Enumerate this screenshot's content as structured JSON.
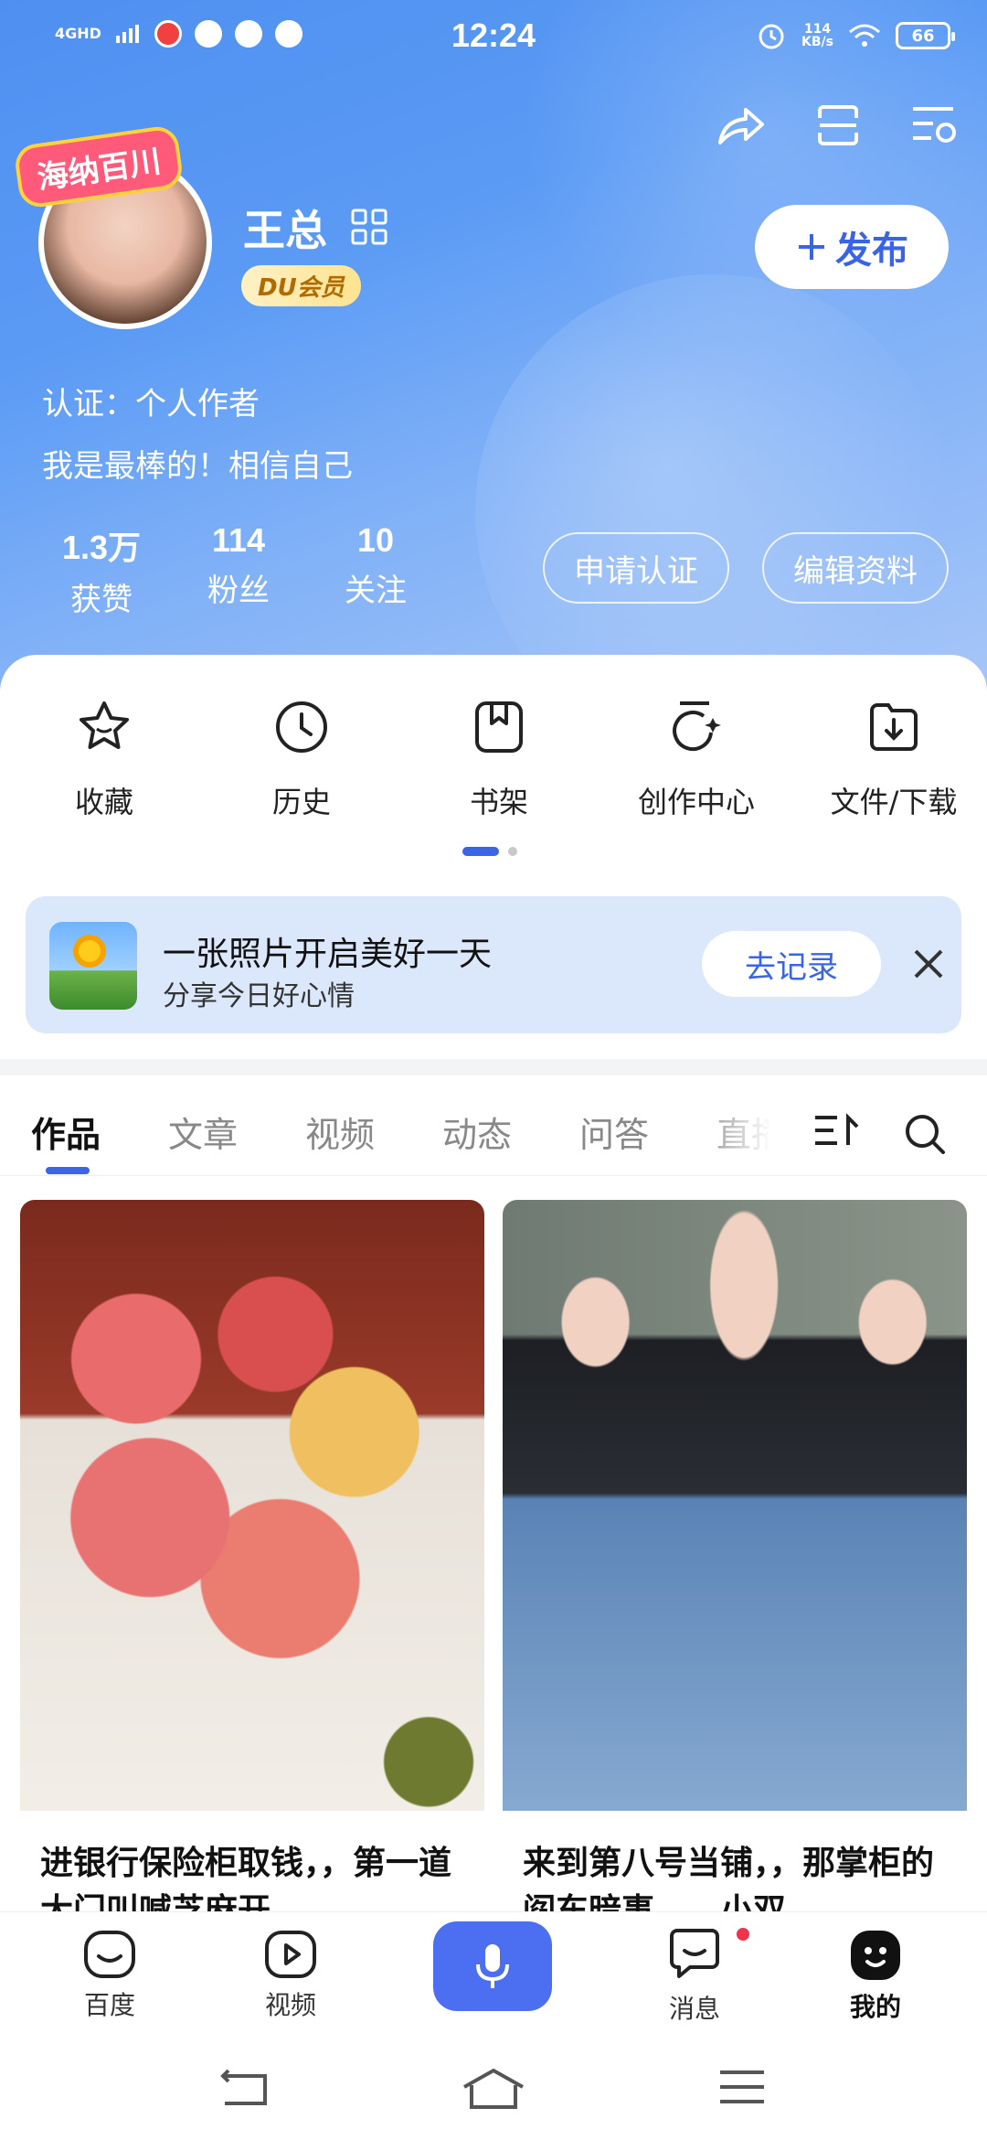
{
  "status_bar": {
    "network": "4GHD",
    "time": "12:24",
    "speed_value": "114",
    "speed_unit": "KB/s",
    "battery": "66"
  },
  "profile": {
    "sticker_text": "海纳百川",
    "username": "王总",
    "vip_badge": "DU会员",
    "publish_label": "发布",
    "certification": "认证：个人作者",
    "bio": "我是最棒的！相信自己",
    "stats": [
      {
        "value": "1.3万",
        "label": "获赞"
      },
      {
        "value": "114",
        "label": "粉丝"
      },
      {
        "value": "10",
        "label": "关注"
      }
    ],
    "apply_cert_label": "申请认证",
    "edit_profile_label": "编辑资料"
  },
  "quick_actions": [
    {
      "label": "收藏",
      "icon": "star-icon"
    },
    {
      "label": "历史",
      "icon": "clock-icon"
    },
    {
      "label": "书架",
      "icon": "bookmark-icon"
    },
    {
      "label": "创作中心",
      "icon": "create-icon"
    },
    {
      "label": "文件/下载",
      "icon": "download-icon"
    }
  ],
  "banner": {
    "title": "一张照片开启美好一天",
    "subtitle": "分享今日好心情",
    "action_label": "去记录"
  },
  "content_tabs": [
    "作品",
    "文章",
    "视频",
    "动态",
    "问答",
    "直播"
  ],
  "active_tab": "作品",
  "posts": [
    {
      "title": "进银行保险柜取钱，，第一道大门叫喊芝麻开"
    },
    {
      "title": "来到第八号当铺，，那掌柜的阎东暗事……小双"
    }
  ],
  "bottom_nav": [
    {
      "label": "百度",
      "icon": "baidu-face-icon"
    },
    {
      "label": "视频",
      "icon": "video-play-icon"
    },
    {
      "label": "",
      "icon": "microphone-icon"
    },
    {
      "label": "消息",
      "icon": "message-icon"
    },
    {
      "label": "我的",
      "icon": "me-icon"
    }
  ],
  "colors": {
    "accent": "#3c64e6",
    "header_gradient_start": "#4f8ff0",
    "header_gradient_end": "#a9c7f8",
    "banner_bg": "#dbe8fb",
    "notification_dot": "#f2334b"
  }
}
